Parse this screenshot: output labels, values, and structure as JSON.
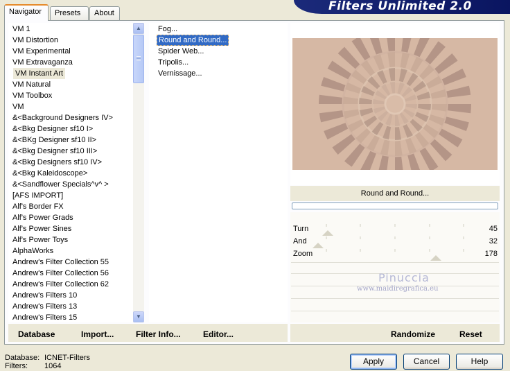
{
  "tabs": [
    "Navigator",
    "Presets",
    "About"
  ],
  "banner_title": "Filters Unlimited 2.0",
  "categories": [
    "VM 1",
    "VM Distortion",
    "VM Experimental",
    "VM Extravaganza",
    "VM Instant Art",
    "VM Natural",
    "VM Toolbox",
    "VM",
    "&<Background Designers IV>",
    "&<Bkg Designer sf10 I>",
    "&<BKg Designer sf10 II>",
    "&<Bkg Designer sf10 III>",
    "&<Bkg Designers sf10 IV>",
    "&<Bkg Kaleidoscope>",
    "&<Sandflower Specials^v^ >",
    "[AFS IMPORT]",
    "Alf's Border FX",
    "Alf's Power Grads",
    "Alf's Power Sines",
    "Alf's Power Toys",
    "AlphaWorks",
    "Andrew's Filter Collection 55",
    "Andrew's Filter Collection 56",
    "Andrew's Filter Collection 62",
    "Andrew's Filters 10",
    "Andrew's Filters 13",
    "Andrew's Filters 15"
  ],
  "selected_category_index": 4,
  "filters": [
    "Fog...",
    "Round and Round...",
    "Spider Web...",
    "Tripolis...",
    "Vernissage..."
  ],
  "selected_filter_index": 1,
  "filter_name": "Round and Round...",
  "params": [
    {
      "label": "Turn",
      "value": "45",
      "level": 45
    },
    {
      "label": "And",
      "value": "32",
      "level": 32
    },
    {
      "label": "Zoom",
      "value": "178",
      "level": 178
    }
  ],
  "watermark": {
    "name": "Pinuccia",
    "url": "www.maidiregrafica.eu"
  },
  "left_buttons": [
    "Database",
    "Import...",
    "Filter Info...",
    "Editor..."
  ],
  "right_buttons": [
    "Randomize",
    "Reset"
  ],
  "status": {
    "database_label": "Database:",
    "database_value": "ICNET-Filters",
    "filters_label": "Filters:",
    "filters_value": "1064"
  },
  "dialog_buttons": [
    "Apply",
    "Cancel",
    "Help"
  ],
  "colors": {
    "selection": "#316ac5",
    "banner": "#0a1560",
    "preview_base": "#d6b8a4"
  }
}
